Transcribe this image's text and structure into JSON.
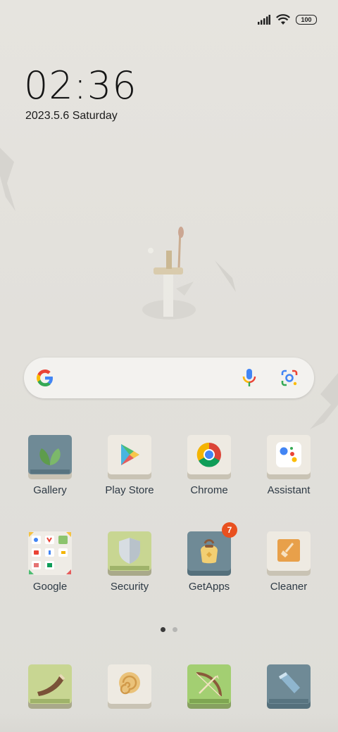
{
  "status_bar": {
    "battery_level": "100",
    "icons": [
      "signal-icon",
      "wifi-icon",
      "battery-icon"
    ]
  },
  "lock_clock": {
    "time": "02:36",
    "date": "2023.5.6 Saturday"
  },
  "search_bar": {
    "icons": [
      "google-g-icon",
      "microphone-icon",
      "google-lens-icon"
    ]
  },
  "apps_row1": [
    {
      "label": "Gallery"
    },
    {
      "label": "Play Store"
    },
    {
      "label": "Chrome"
    },
    {
      "label": "Assistant"
    }
  ],
  "apps_row2": [
    {
      "label": "Google"
    },
    {
      "label": "Security"
    },
    {
      "label": "GetApps",
      "badge": "7"
    },
    {
      "label": "Cleaner"
    }
  ],
  "page_indicator": {
    "pages": 2,
    "current": 1
  },
  "dock": [
    {
      "icon": "horn-icon"
    },
    {
      "icon": "snail-shell-icon"
    },
    {
      "icon": "bow-icon"
    },
    {
      "icon": "flashlight-icon"
    }
  ],
  "colors": {
    "wallpaper": "#e4e2dd",
    "label_text": "#2e3a45",
    "badge": "#e9501f"
  }
}
